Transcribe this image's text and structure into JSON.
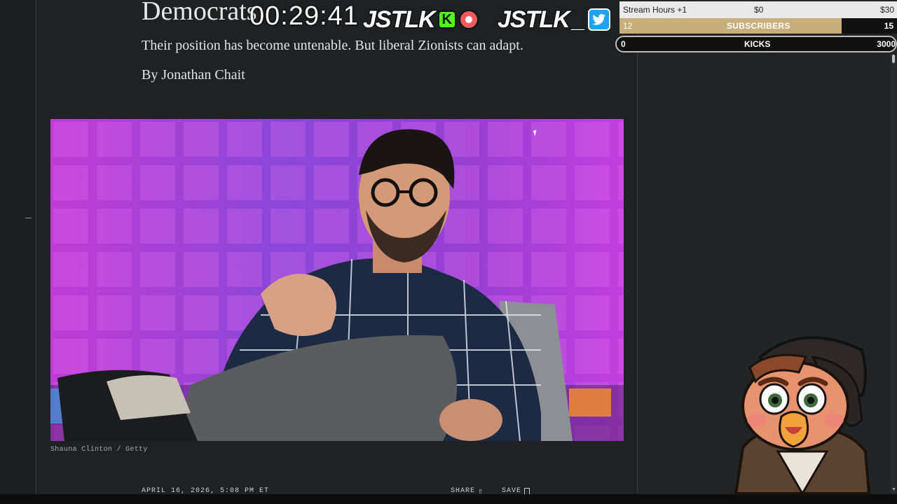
{
  "article": {
    "headline_partial": "Democrats",
    "dek": "Their position has become untenable. But liberal Zionists can adapt.",
    "byline": "By Jonathan Chait",
    "photo_credit": "Shauna Clinton / Getty",
    "dateline": "APRIL 16, 2026, 5:08 PM ET",
    "share_label": "SHARE",
    "save_label": "SAVE",
    "share_icon": "share-upload-icon",
    "save_icon": "bookmark-icon"
  },
  "overlay": {
    "timer": "00:29:41",
    "brand_left": "JSTLK",
    "brand_left_badge": "K",
    "brand_right": "JSTLK",
    "brand_right_suffix": "_",
    "kick_color": "#53fc18",
    "twitter_color": "#1da1f2"
  },
  "goals": {
    "stream_hours": {
      "label": "Stream Hours +1",
      "current": "$0",
      "target": "$30"
    },
    "subscribers": {
      "current": "12",
      "label": "SUBSCRIBERS",
      "target": "15",
      "progress": 0.8,
      "fill_color": "#c8ae7a"
    },
    "kicks": {
      "current": "0",
      "label": "KICKS",
      "target": "3000",
      "progress": 0
    }
  }
}
